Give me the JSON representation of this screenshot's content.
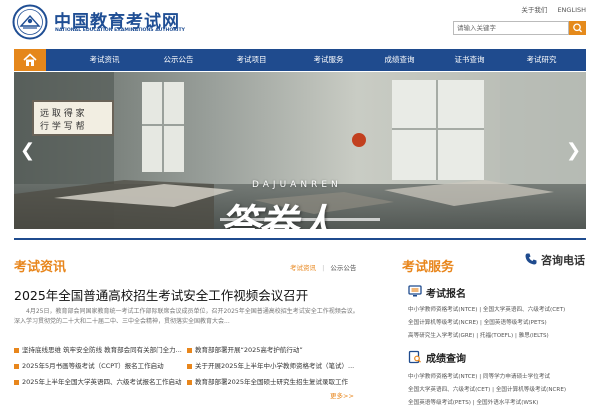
{
  "header": {
    "site_name_cn": "中国教育考试网",
    "site_name_en": "NATIONAL EDUCATION EXAMINATIONS AUTHORITY",
    "about": "关于我们",
    "english": "ENGLISH",
    "search_placeholder": "请输入关键字"
  },
  "nav": {
    "items": [
      "考试资讯",
      "公示公告",
      "考试项目",
      "考试服务",
      "成绩查询",
      "证书查询",
      "考试研究"
    ]
  },
  "banner": {
    "title": "答卷人",
    "subtitle": "DAJUANREN",
    "prev": "❮",
    "next": "❯"
  },
  "news_section": {
    "title": "考试资讯",
    "tab_active": "考试资讯",
    "separator": "|",
    "tab_other": "公示公告",
    "headline": "2025年全国普通高校招生考试安全工作视频会议召开",
    "summary": "4月25日，教育部会同国家教育统一考试工作部际联席会议成员单位，召开2025年全国普通高校招生考试安全工作视频会议。深入学习贯彻党的二十大和二十届二中、三中全会精神，贯彻落实全国教育大会...",
    "items": [
      "坚持底线思维 筑牢安全防线 教育部会同有关部门全力...",
      "教育部部署开展“2025高考护航行动”",
      "2025年5月书画等级考试（CCPT）报名工作启动",
      "关于开展2025年上半年中小学教师资格考试（笔试）...",
      "2025年上半年全国大学英语四、六级考试报名工作启动",
      "教育部部署2025年全国硕士研究生招生复试录取工作"
    ],
    "more": "更多>>"
  },
  "service_section": {
    "title": "考试服务",
    "phone": "咨询电话",
    "registration": {
      "title": "考试报名",
      "links": [
        [
          "中小学教师资格考试(NTCE)",
          "全国大学英语四、六级考试(CET)"
        ],
        [
          "全国计算机等级考试(NCRE)",
          "全国英语等级考试(PETS)"
        ],
        [
          "高等研究生入学考试(GRE)",
          "托福(TOEFL)",
          "雅思(IELTS)"
        ]
      ]
    },
    "scores": {
      "title": "成绩查询",
      "links": [
        [
          "中小学教师资格考试(NTCE)",
          "同等学力申请硕士学位考试"
        ],
        [
          "全国大学英语四、六级考试(CET)",
          "全国计算机等级考试(NCRE)"
        ],
        [
          "全国英语等级考试(PETS)",
          "全国外语水平考试(WSK)"
        ]
      ]
    }
  },
  "colors": {
    "brand_blue": "#1f4b8e",
    "accent_orange": "#e8861c"
  }
}
